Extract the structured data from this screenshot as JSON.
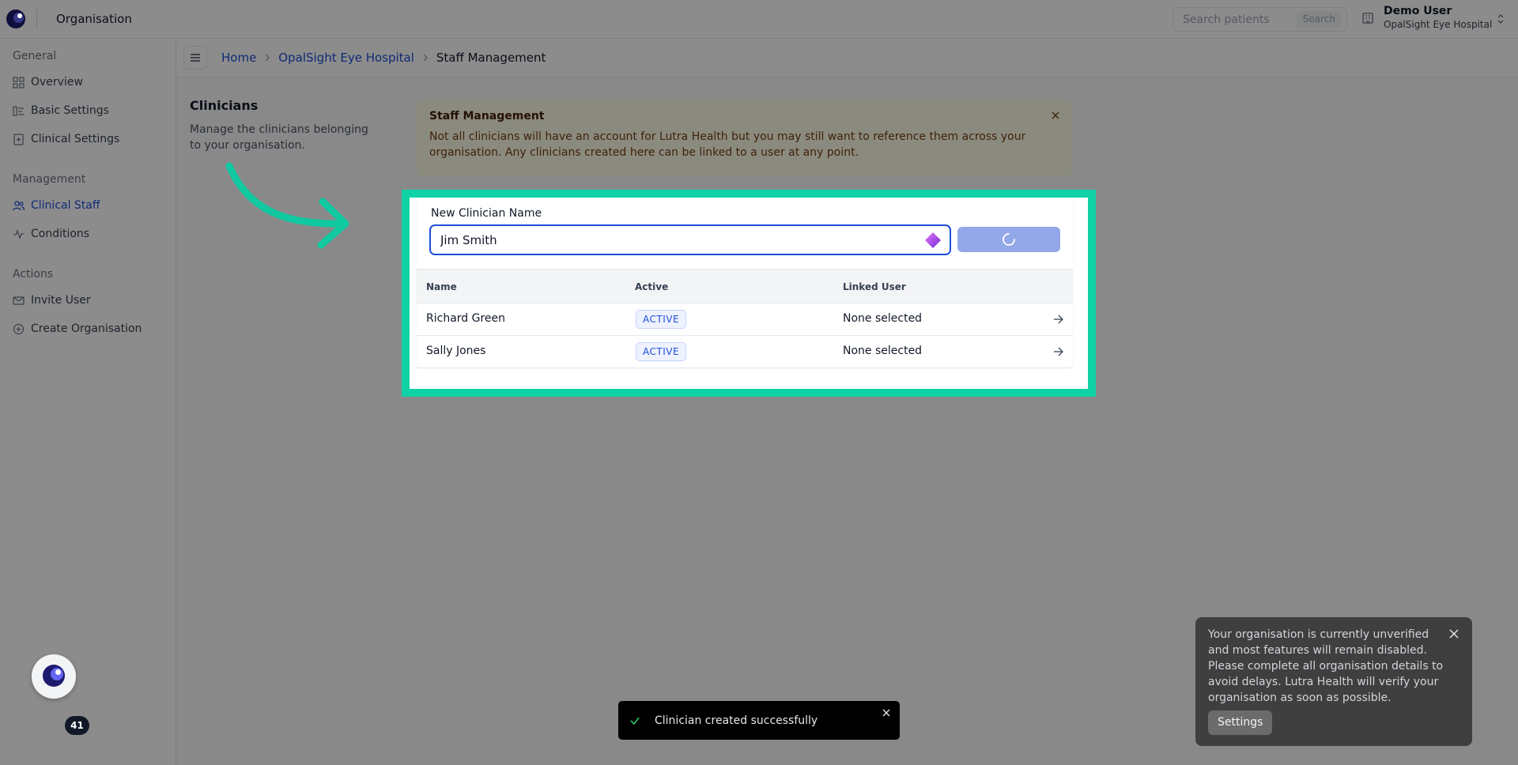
{
  "topbar": {
    "title": "Organisation",
    "search_placeholder": "Search patients",
    "search_button": "Search",
    "user_name": "Demo User",
    "user_org": "OpalSight Eye Hospital"
  },
  "sidebar": {
    "sections": [
      {
        "label": "General",
        "items": [
          {
            "label": "Overview",
            "icon": "grid-icon"
          },
          {
            "label": "Basic Settings",
            "icon": "sliders-icon"
          },
          {
            "label": "Clinical Settings",
            "icon": "clipboard-icon"
          }
        ]
      },
      {
        "label": "Management",
        "items": [
          {
            "label": "Clinical Staff",
            "icon": "users-icon",
            "active": true
          },
          {
            "label": "Conditions",
            "icon": "activity-icon"
          }
        ]
      },
      {
        "label": "Actions",
        "items": [
          {
            "label": "Invite User",
            "icon": "mail-icon"
          },
          {
            "label": "Create Organisation",
            "icon": "plus-circle-icon"
          }
        ]
      }
    ],
    "notification_count": "41"
  },
  "breadcrumb": {
    "items": [
      "Home",
      "OpalSight Eye Hospital",
      "Staff Management"
    ]
  },
  "clinicians": {
    "title": "Clinicians",
    "description": "Manage the clinicians belonging to your organisation."
  },
  "info": {
    "title": "Staff Management",
    "text": "Not all clinicians will have an account for Lutra Health but you may still want to reference them across your organisation. Any clinicians created here can be linked to a user at any point."
  },
  "form": {
    "label": "New Clinician Name",
    "value": "Jim Smith"
  },
  "table": {
    "headers": [
      "Name",
      "Active",
      "Linked User"
    ],
    "rows": [
      {
        "name": "Richard Green",
        "status": "ACTIVE",
        "linked": "None selected"
      },
      {
        "name": "Sally Jones",
        "status": "ACTIVE",
        "linked": "None selected"
      }
    ]
  },
  "toast": {
    "message": "Clinician created successfully"
  },
  "notice": {
    "text": "Your organisation is currently unverified and most features will remain disabled. Please complete all organisation details to avoid delays. Lutra Health will verify your organisation as soon as possible.",
    "button": "Settings"
  },
  "colors": {
    "accent": "#1d4ed8",
    "highlight": "#10d2a6",
    "info_bg": "#fefce8"
  }
}
